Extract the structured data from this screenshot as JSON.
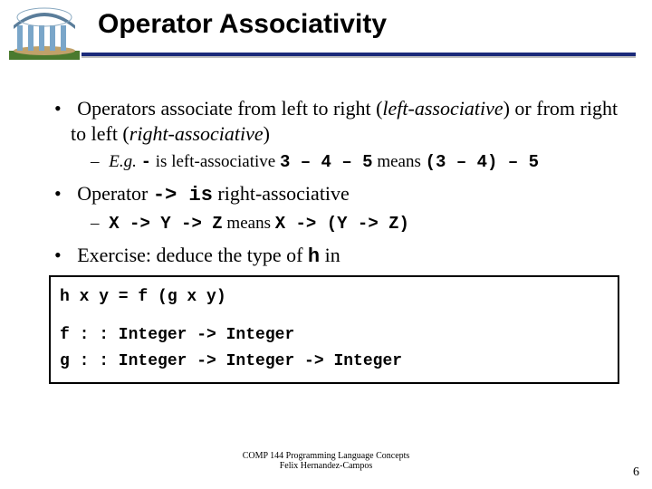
{
  "title": "Operator Associativity",
  "b1": {
    "a": "Operators associate from left to right (",
    "i1": "left-associative",
    "b": ") or from right to left (",
    "i2": "right-associative",
    "c": ")"
  },
  "s1": {
    "eg": "E.g. ",
    "op": "-",
    "mid": " is left-associative ",
    "e1": "3 – 4 – 5",
    "means": " means ",
    "e2": "(3 – 4) – 5"
  },
  "b2": {
    "a": "Operator ",
    "op": "-> is",
    "b": " right-associative"
  },
  "s2": {
    "e1": "X -> Y -> Z",
    "means": " means ",
    "e2": "X -> (Y -> Z)"
  },
  "b3": {
    "a": "Exercise: deduce the type of ",
    "h": "h",
    "b": " in"
  },
  "code": {
    "l1": "h x y = f (g x y)",
    "l2": "f : : Integer -> Integer",
    "l3": "g : : Integer -> Integer -> Integer"
  },
  "footer": {
    "l1": "COMP 144 Programming Language Concepts",
    "l2": "Felix Hernandez-Campos"
  },
  "page": "6"
}
